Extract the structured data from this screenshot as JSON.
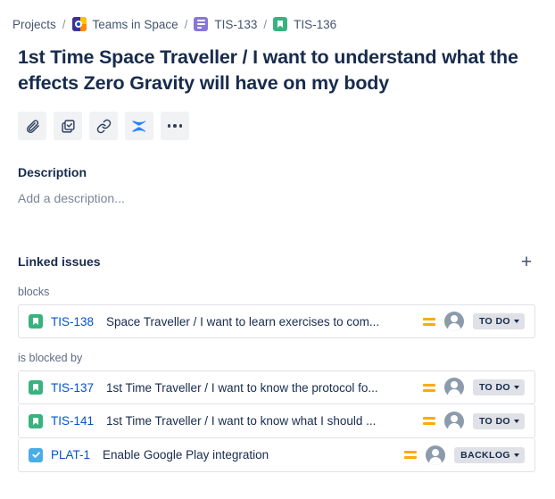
{
  "breadcrumb": {
    "items": [
      {
        "label": "Projects",
        "icon": null
      },
      {
        "label": "Teams in Space",
        "icon": "project-avatar-icon"
      },
      {
        "label": "TIS-133",
        "icon": "epic-issue-type-icon"
      },
      {
        "label": "TIS-136",
        "icon": "story-issue-type-icon"
      }
    ],
    "separator": "/"
  },
  "issue": {
    "title": "1st Time Space Traveller / I want to understand what the effects Zero Gravity will have on my body"
  },
  "toolbar": {
    "buttons": [
      {
        "name": "attach-button",
        "icon": "paperclip-icon",
        "label": "Attach"
      },
      {
        "name": "add-child-issue-button",
        "icon": "child-issue-icon",
        "label": "Add a child issue"
      },
      {
        "name": "link-issue-button",
        "icon": "link-icon",
        "label": "Link issue"
      },
      {
        "name": "apps-button",
        "icon": "apps-icon",
        "label": "Apps"
      },
      {
        "name": "more-actions-button",
        "icon": "more-ellipsis-icon",
        "label": "More actions"
      }
    ]
  },
  "description": {
    "heading": "Description",
    "placeholder": "Add a description..."
  },
  "linked_issues": {
    "heading": "Linked issues",
    "add_label": "+",
    "groups": [
      {
        "label": "blocks",
        "rows": [
          {
            "type_icon": "story-issue-type-icon",
            "key": "TIS-138",
            "summary": "Space Traveller / I want to learn exercises to com...",
            "priority_icon": "medium-priority-icon",
            "avatar": "unassigned-avatar-icon",
            "status": "TO DO"
          }
        ]
      },
      {
        "label": "is blocked by",
        "rows": [
          {
            "type_icon": "story-issue-type-icon",
            "key": "TIS-137",
            "summary": "1st Time Traveller / I want to know the protocol fo...",
            "priority_icon": "medium-priority-icon",
            "avatar": "unassigned-avatar-icon",
            "status": "TO DO"
          },
          {
            "type_icon": "story-issue-type-icon",
            "key": "TIS-141",
            "summary": "1st Time Traveller / I want to know what I should ...",
            "priority_icon": "medium-priority-icon",
            "avatar": "unassigned-avatar-icon",
            "status": "TO DO"
          },
          {
            "type_icon": "task-issue-type-icon",
            "key": "PLAT-1",
            "summary": "Enable Google Play integration",
            "priority_icon": "medium-priority-icon",
            "avatar": "unassigned-avatar-icon",
            "status": "BACKLOG"
          }
        ]
      }
    ]
  },
  "colors": {
    "link": "#0052cc",
    "text": "#172b4d",
    "subtle_text": "#5e6c84",
    "story_green": "#36b37e",
    "task_blue": "#4bade8",
    "epic_purple": "#8777d9",
    "priority_orange": "#ffab00",
    "badge_bg": "#dfe1e6",
    "button_bg": "#f1f2f4"
  }
}
